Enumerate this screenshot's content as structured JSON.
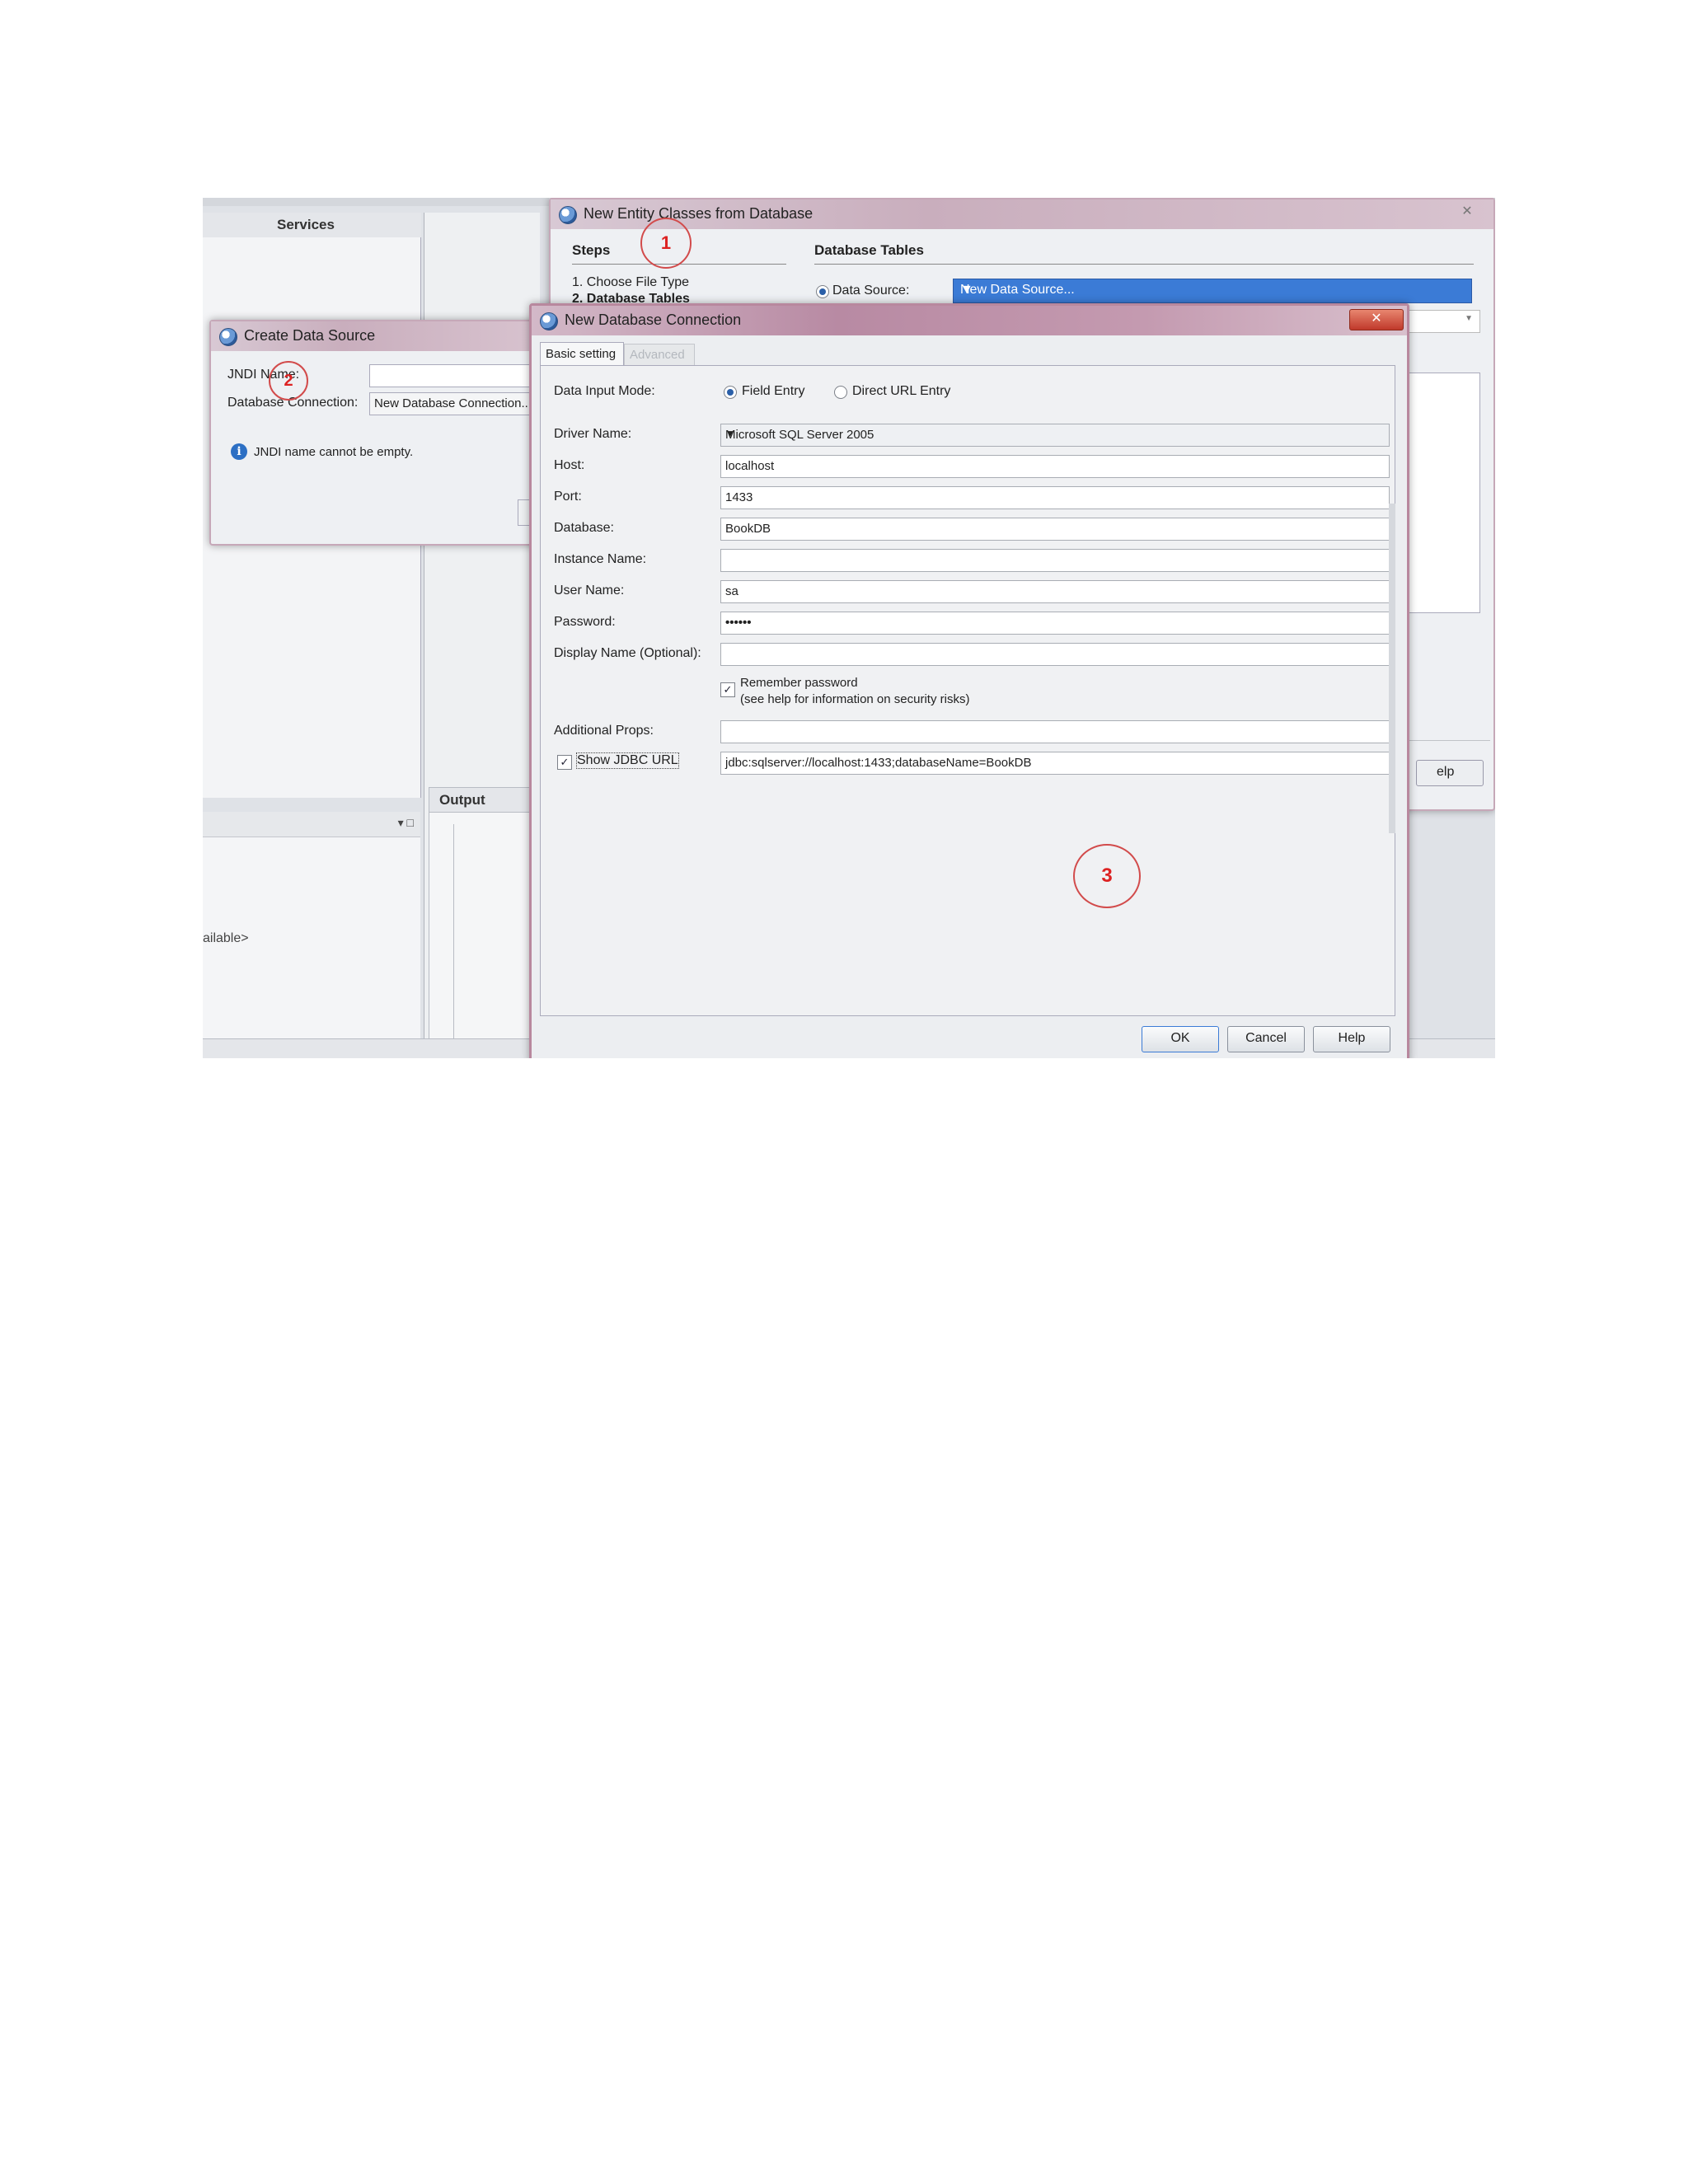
{
  "ide": {
    "services_tab": "Services",
    "output_tab": "Output",
    "lower_icons": "▾ □",
    "available_text": "ailable>"
  },
  "entity_window": {
    "title": "New Entity Classes from Database",
    "close": "✕",
    "steps_header": "Steps",
    "steps": [
      "1.   Choose File Type",
      "2.   Database Tables"
    ],
    "content_header": "Database Tables",
    "data_source_label": "Data Source:",
    "data_source_value": "New Data Source...",
    "help_partial": "elp"
  },
  "create_ds_window": {
    "title": "Create Data Source",
    "jndi_label": "JNDI Name:",
    "conn_label": "Database Connection:",
    "conn_value": "New Database Connection...",
    "info_icon": "i",
    "message": "JNDI name cannot be empty."
  },
  "ndc_window": {
    "title": "New Database Connection",
    "close": "✕",
    "tabs": [
      "Basic setting",
      "Advanced"
    ],
    "data_input_mode_label": "Data Input Mode:",
    "mode_field_entry": "Field Entry",
    "mode_direct_url": "Direct URL Entry",
    "driver_label": "Driver Name:",
    "driver_value": "Microsoft SQL Server 2005",
    "host_label": "Host:",
    "host_value": "localhost",
    "port_label": "Port:",
    "port_value": "1433",
    "database_label": "Database:",
    "database_value": "BookDB",
    "instance_label": "Instance Name:",
    "instance_value": "",
    "user_label": "User Name:",
    "user_value": "sa",
    "password_label": "Password:",
    "password_value": "••••••",
    "display_name_label": "Display Name (Optional):",
    "display_name_value": "",
    "remember_password": "Remember password",
    "remember_hint": "(see help for information on security risks)",
    "additional_props_label": "Additional Props:",
    "additional_props_value": "",
    "show_jdbc_url": "Show JDBC URL",
    "jdbc_url_value": "jdbc:sqlserver://localhost:1433;databaseName=BookDB",
    "ok": "OK",
    "cancel": "Cancel",
    "help": "Help"
  },
  "annotations": [
    "1",
    "2",
    "3"
  ],
  "colors": {
    "annotation": "#d24b4b",
    "selection": "#3b7bd6",
    "title_bar": "#c49ab0"
  }
}
